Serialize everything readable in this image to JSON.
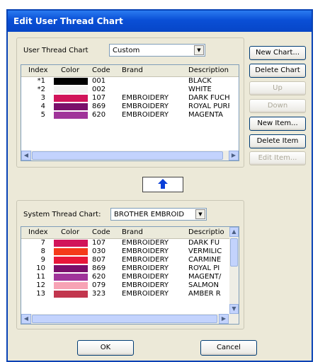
{
  "window": {
    "title": "Edit User Thread Chart"
  },
  "user_chart": {
    "label": "User Thread Chart",
    "selected": "Custom",
    "columns": [
      "Index",
      "Color",
      "Code",
      "Brand",
      "Description"
    ],
    "rows": [
      {
        "index": "*1",
        "color": "#000000",
        "code": "001",
        "brand": "",
        "description": "BLACK"
      },
      {
        "index": "*2",
        "color": "#f2f2f2",
        "code": "002",
        "brand": "",
        "description": "WHITE"
      },
      {
        "index": "3",
        "color": "#d1145a",
        "code": "107",
        "brand": "EMBROIDERY",
        "description": "DARK FUCHS"
      },
      {
        "index": "4",
        "color": "#7a0f6b",
        "code": "869",
        "brand": "EMBROIDERY",
        "description": "ROYAL PURP"
      },
      {
        "index": "5",
        "color": "#a0349a",
        "code": "620",
        "brand": "EMBROIDERY",
        "description": "MAGENTA"
      }
    ]
  },
  "buttons": {
    "new_chart": "New Chart...",
    "delete_chart": "Delete Chart",
    "up": "Up",
    "down": "Down",
    "new_item": "New Item...",
    "delete_item": "Delete Item",
    "edit_item": "Edit Item...",
    "ok": "OK",
    "cancel": "Cancel"
  },
  "icons": {
    "transfer": "up-arrow-icon"
  },
  "system_chart": {
    "label": "System Thread Chart:",
    "selected": "BROTHER EMBROID",
    "columns": [
      "Index",
      "Color",
      "Code",
      "Brand",
      "Descriptio"
    ],
    "rows": [
      {
        "index": "7",
        "color": "#d1145a",
        "code": "107",
        "brand": "EMBROIDERY",
        "description": "DARK FU"
      },
      {
        "index": "8",
        "color": "#f53a1a",
        "code": "030",
        "brand": "EMBROIDERY",
        "description": "VERMILIC"
      },
      {
        "index": "9",
        "color": "#e8173a",
        "code": "807",
        "brand": "EMBROIDERY",
        "description": "CARMINE"
      },
      {
        "index": "10",
        "color": "#7a0f6b",
        "code": "869",
        "brand": "EMBROIDERY",
        "description": "ROYAL PI"
      },
      {
        "index": "11",
        "color": "#a0349a",
        "code": "620",
        "brand": "EMBROIDERY",
        "description": "MAGENT/"
      },
      {
        "index": "12",
        "color": "#f7a3b5",
        "code": "079",
        "brand": "EMBROIDERY",
        "description": "SALMON"
      },
      {
        "index": "13",
        "color": "#c2364e",
        "code": "323",
        "brand": "EMBROIDERY",
        "description": "AMBER R"
      }
    ]
  }
}
